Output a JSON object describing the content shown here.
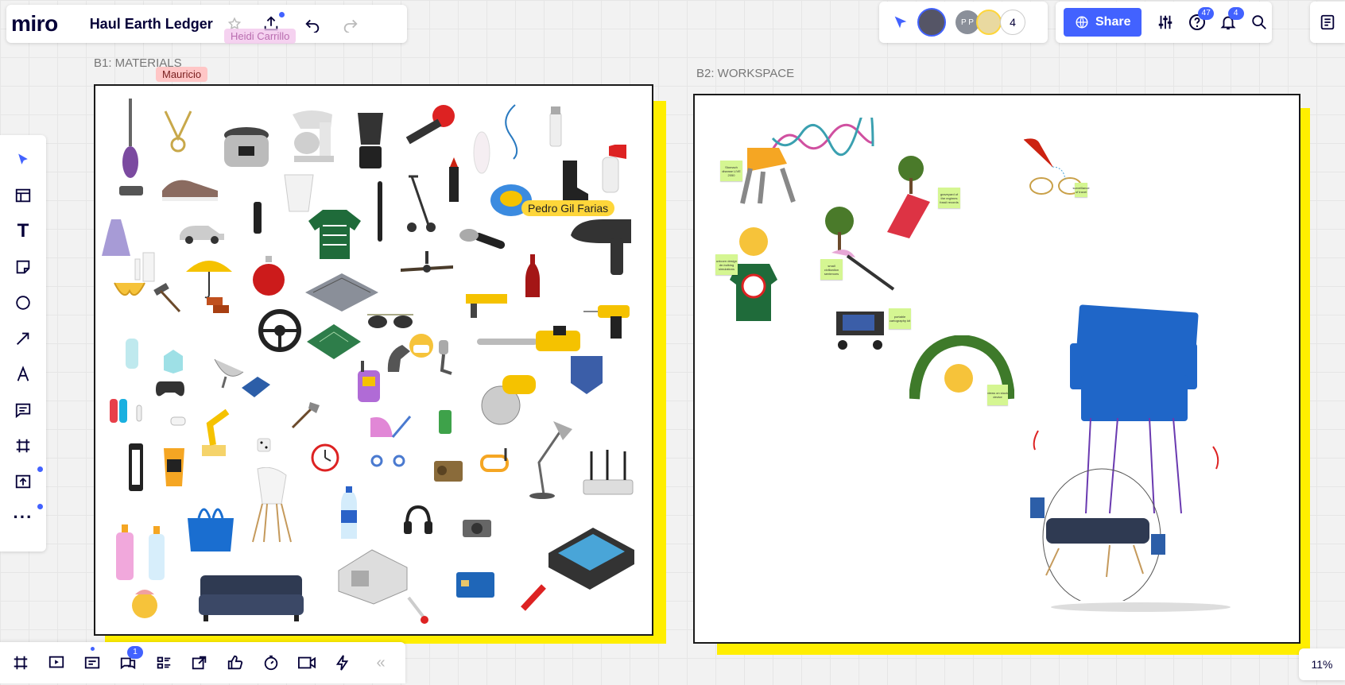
{
  "app": {
    "logo": "miro",
    "board_title": "Haul Earth Ledger"
  },
  "header": {
    "collaborator_count": "4",
    "share_label": "Share",
    "help_badge": "47",
    "notifications_badge": "4",
    "avatar_initials": "P P"
  },
  "frames": {
    "b1_label": "B1: MATERIALS",
    "b2_label": "B2: WORKSPACE"
  },
  "cursors": [
    {
      "name": "Heidi Carrillo",
      "color": "#f2c3ec"
    },
    {
      "name": "Mauricio",
      "color": "#ffc6c6"
    },
    {
      "name": "Pedro Gil Farias",
      "color": "#fed63a"
    }
  ],
  "stickies": [
    "Stomach disease LIVE 2050",
    "unicorn design de-bulking simulations",
    "graveyard of the regimes fossil records",
    "small civilization sentences",
    "portable cartography kit",
    "surveillance of travel",
    "views on stuck device"
  ],
  "bottom_toolbar": {
    "comments_badge": "1",
    "collapse_icon": "«"
  },
  "zoom_level": "11%",
  "colors": {
    "accent": "#4262ff",
    "frame_accent": "#ffee00",
    "sticky": "#d5f692"
  }
}
